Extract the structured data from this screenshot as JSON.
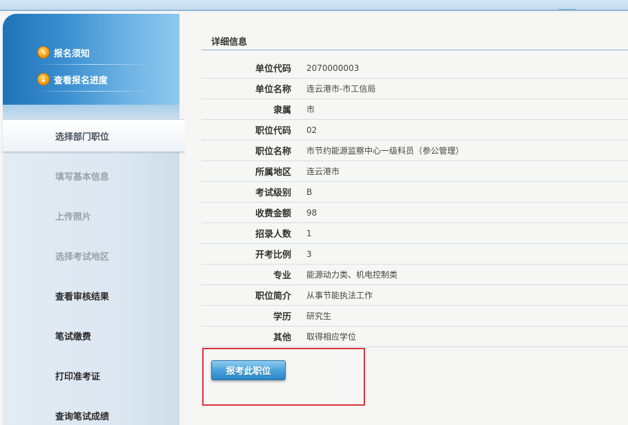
{
  "colors": {
    "accent": "#2c86c7",
    "sidebar_head": "#3a8fd0",
    "highlight_box": "#d8343a"
  },
  "sidebar": {
    "quick_links": [
      {
        "label": "报名须知",
        "icon": "pencil-icon"
      },
      {
        "label": "查看报名进度",
        "icon": "download-icon"
      }
    ],
    "nav_items": [
      {
        "label": "选择部门职位",
        "state": "active"
      },
      {
        "label": "填写基本信息",
        "state": "disabled"
      },
      {
        "label": "上传照片",
        "state": "disabled"
      },
      {
        "label": "选择考试地区",
        "state": "disabled"
      },
      {
        "label": "查看审核结果",
        "state": "enabled"
      },
      {
        "label": "笔试缴费",
        "state": "enabled"
      },
      {
        "label": "打印准考证",
        "state": "enabled"
      },
      {
        "label": "查询笔试成绩",
        "state": "enabled"
      }
    ]
  },
  "main": {
    "section_title": "详细信息",
    "rows": [
      {
        "label": "单位代码",
        "value": "2070000003"
      },
      {
        "label": "单位名称",
        "value": "连云港市-市工信局"
      },
      {
        "label": "隶属",
        "value": "市"
      },
      {
        "label": "职位代码",
        "value": "02"
      },
      {
        "label": "职位名称",
        "value": "市节约能源监察中心一级科员（参公管理）"
      },
      {
        "label": "所属地区",
        "value": "连云港市"
      },
      {
        "label": "考试级别",
        "value": "B"
      },
      {
        "label": "收费金额",
        "value": "98"
      },
      {
        "label": "招录人数",
        "value": "1"
      },
      {
        "label": "开考比例",
        "value": "3"
      },
      {
        "label": "专业",
        "value": "能源动力类、机电控制类"
      },
      {
        "label": "职位简介",
        "value": "从事节能执法工作"
      },
      {
        "label": "学历",
        "value": "研究生"
      },
      {
        "label": "其他",
        "value": "取得相应学位"
      }
    ],
    "apply_button": "报考此职位"
  }
}
